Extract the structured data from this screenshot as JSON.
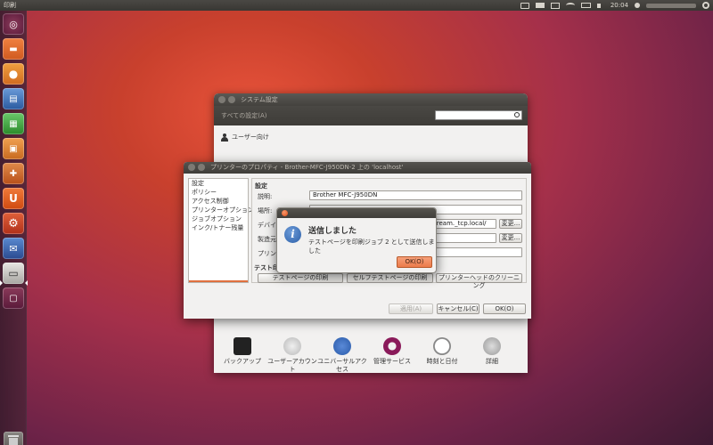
{
  "top_panel": {
    "app_title": "印刷",
    "clock": "20:04",
    "icons": [
      "keyboard-icon",
      "printer-icon",
      "mail-icon",
      "wifi-icon",
      "battery-icon",
      "volume-icon",
      "user-icon",
      "power-gear-icon"
    ]
  },
  "launcher": {
    "items": [
      {
        "name": "ubuntu-dash",
        "color": "#6a2a4a"
      },
      {
        "name": "files",
        "color": "#e06a2a"
      },
      {
        "name": "firefox",
        "color": "#e87a1a"
      },
      {
        "name": "writer",
        "color": "#3a6ab0"
      },
      {
        "name": "calc",
        "color": "#3a9a3a"
      },
      {
        "name": "impress",
        "color": "#d87a2a"
      },
      {
        "name": "software-center",
        "color": "#c8602a"
      },
      {
        "name": "ubuntu-one",
        "color": "#e05a20"
      },
      {
        "name": "system-settings",
        "color": "#c84a2a"
      },
      {
        "name": "thunderbird",
        "color": "#3a70b0"
      },
      {
        "name": "printer",
        "color": "#888888"
      },
      {
        "name": "workspace",
        "color": "#7a2a4a"
      }
    ],
    "trash": "trash"
  },
  "system_settings": {
    "title": "システム設定",
    "all_settings": "すべての設定(A)",
    "search_placeholder": "",
    "section_personal": "ユーザー向け",
    "bottom_items": [
      {
        "label": "バックアップ",
        "color": "#2a2a2a"
      },
      {
        "label": "ユーザーアカウント",
        "color": "#d8d8d8"
      },
      {
        "label": "ユニバーサルアクセス",
        "color": "#3a6ab8"
      },
      {
        "label": "管理サービス",
        "color": "#8a1a5a"
      },
      {
        "label": "時刻と日付",
        "color": "#888888"
      },
      {
        "label": "詳細",
        "color": "#bbbbbb"
      }
    ]
  },
  "printer_properties": {
    "title": "プリンターのプロパティ - Brother-MFC-J950DN-2 上の 'localhost'",
    "side_items": [
      "設定",
      "ポリシー",
      "アクセス制御",
      "プリンターオプション",
      "ジョブオプション",
      "インク/トナー残量"
    ],
    "settings_head": "設定",
    "fields": {
      "description_label": "説明:",
      "description_value": "Brother MFC-J950DN",
      "location_label": "場所:",
      "location_value": "",
      "device_label": "デバイ",
      "device_value": "tream._tcp.local/",
      "maker_label": "製造元",
      "maker_value": "",
      "printer_state_label": "プリンタ",
      "change_button": "変更..."
    },
    "test_head": "テスト印",
    "test_buttons": [
      "テストページの印刷",
      "セルフテストページの印刷",
      "プリンターヘッドのクリーニング"
    ],
    "footer": {
      "apply": "適用(A)",
      "cancel": "キャンセル(C)",
      "ok": "OK(O)"
    }
  },
  "dialog": {
    "title": "送信しました",
    "message": "テストページを印刷ジョブ 2 として送信しました",
    "ok": "OK(O)"
  }
}
